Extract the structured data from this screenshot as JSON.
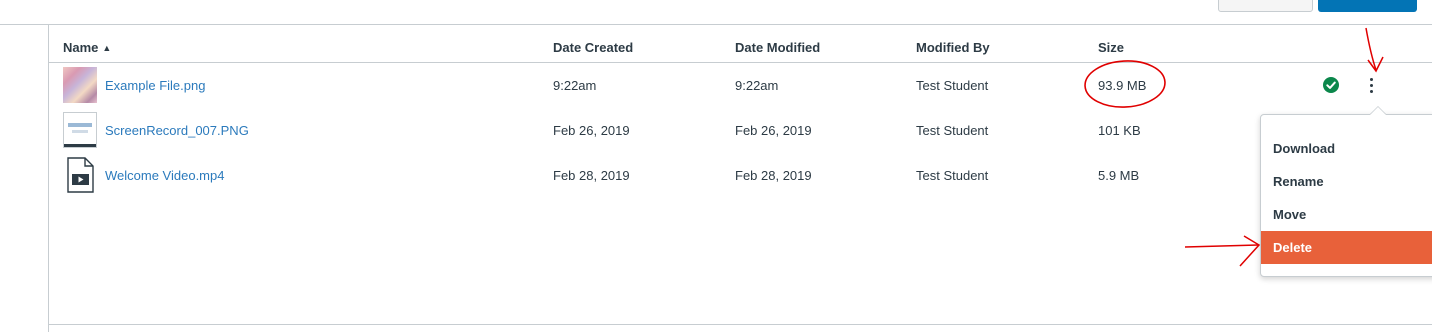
{
  "table": {
    "columns": {
      "name": "Name",
      "date_created": "Date Created",
      "date_modified": "Date Modified",
      "modified_by": "Modified By",
      "size": "Size"
    },
    "sort_indicator": "▲",
    "rows": [
      {
        "name": "Example File.png",
        "date_created": "9:22am",
        "date_modified": "9:22am",
        "modified_by": "Test Student",
        "size": "93.9 MB",
        "thumbnail": "image-thumbnail",
        "status": "published"
      },
      {
        "name": "ScreenRecord_007.PNG",
        "date_created": "Feb 26, 2019",
        "date_modified": "Feb 26, 2019",
        "modified_by": "Test Student",
        "size": "101 KB",
        "thumbnail": "screenshot-thumbnail"
      },
      {
        "name": "Welcome Video.mp4",
        "date_created": "Feb 28, 2019",
        "date_modified": "Feb 28, 2019",
        "modified_by": "Test Student",
        "size": "5.9 MB",
        "thumbnail": "video-file-icon"
      }
    ]
  },
  "context_menu": {
    "items": [
      "Download",
      "Rename",
      "Move",
      "Delete"
    ],
    "highlighted": "Delete"
  },
  "icons": {
    "status": "check-circle-icon",
    "more": "kebab-menu-icon"
  },
  "colors": {
    "link": "#2b7abc",
    "text": "#2d3b45",
    "status_green": "#0b874b",
    "menu_highlight": "#e8613a",
    "annotation_red": "#e00000",
    "primary_button": "#0374b5"
  }
}
